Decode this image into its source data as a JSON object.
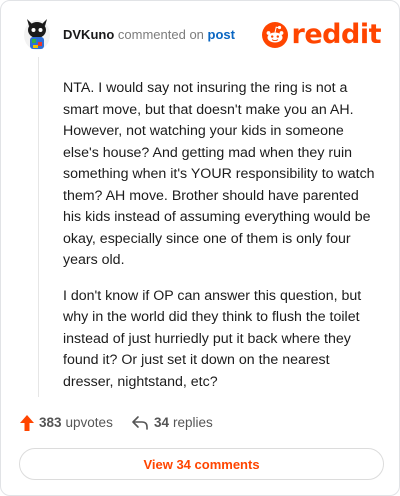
{
  "header": {
    "username": "DVKuno",
    "action": "commented on",
    "post_link": "post",
    "brand": "reddit"
  },
  "comment": {
    "paragraphs": [
      "NTA. I would say not insuring the ring is not a smart move, but that doesn't make you an AH. However, not watching your kids in someone else's house? And getting mad when they ruin something when it's YOUR responsibility to watch them? AH move. Brother should have parented his kids instead of assuming everything would be okay, especially since one of them is only four years old.",
      "I don't know if OP can answer this question, but why in the world did they think to flush the toilet instead of just hurriedly put it back where they found it? Or just set it down on the nearest dresser, nightstand, etc?"
    ]
  },
  "footer": {
    "upvotes_count": "383",
    "upvotes_label": "upvotes",
    "replies_count": "34",
    "replies_label": "replies",
    "view_button": "View 34 comments"
  },
  "colors": {
    "accent": "#ff4500",
    "link": "#0a66c2"
  },
  "icons": {
    "avatar": "snoo-avatar",
    "logo": "reddit-snoo-icon",
    "upvote": "arrow-up-icon",
    "reply": "reply-arrow-icon"
  }
}
